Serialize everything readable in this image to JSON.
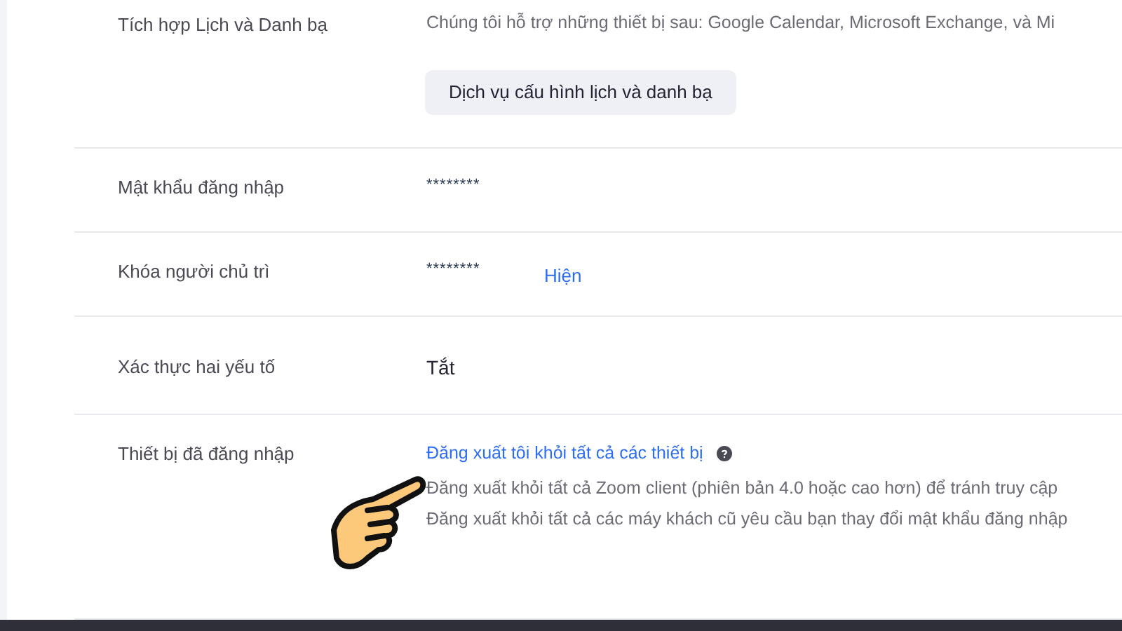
{
  "rows": [
    {
      "kind": "calendar",
      "label": "Tích hợp Lịch và Danh bạ",
      "description": "Chúng tôi hỗ trợ những thiết bị sau: Google Calendar, Microsoft Exchange, và Mi",
      "button": "Dịch vụ cấu hình lịch và danh bạ"
    },
    {
      "kind": "secret",
      "label": "Mật khẩu đăng nhập",
      "value": "********"
    },
    {
      "kind": "secret",
      "label": "Khóa người chủ trì",
      "value": "********",
      "link": "Hiện"
    },
    {
      "kind": "plain",
      "label": "Xác thực hai yếu tố",
      "value": "Tắt"
    },
    {
      "kind": "devices",
      "label": "Thiết bị đã đăng nhập",
      "link": "Đăng xuất tôi khỏi tất cả các thiết bị",
      "notes": [
        "Đăng xuất khỏi tất cả Zoom client (phiên bản 4.0 hoặc cao hơn) để tránh truy cập",
        "Đăng xuất khỏi tất cả các máy khách cũ yêu cầu bạn thay đổi mật khẩu đăng nhập"
      ]
    }
  ]
}
